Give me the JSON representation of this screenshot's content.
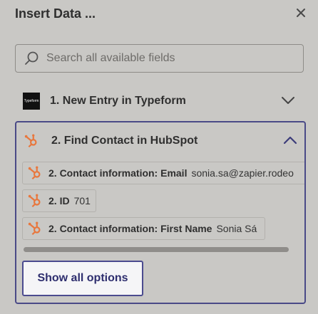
{
  "panel": {
    "title": "Insert Data ...",
    "close_icon": "close-icon"
  },
  "search": {
    "placeholder": "Search all available fields",
    "value": ""
  },
  "steps": [
    {
      "label": "1. New Entry in Typeform",
      "app_logo_text": "Typeform",
      "expanded": false
    },
    {
      "label": "2. Find Contact in HubSpot",
      "expanded": true,
      "fields": [
        {
          "label": "2. Contact information: Email",
          "value": "sonia.sa@zapier.rodeo"
        },
        {
          "label": "2. ID",
          "value": "701"
        },
        {
          "label": "2. Contact information: First Name",
          "value": "Sonia Sá"
        }
      ],
      "show_all_label": "Show all options"
    }
  ],
  "colors": {
    "accent": "#4b4b8f",
    "hubspot": "#e8773d",
    "background": "#c9c8c5"
  }
}
